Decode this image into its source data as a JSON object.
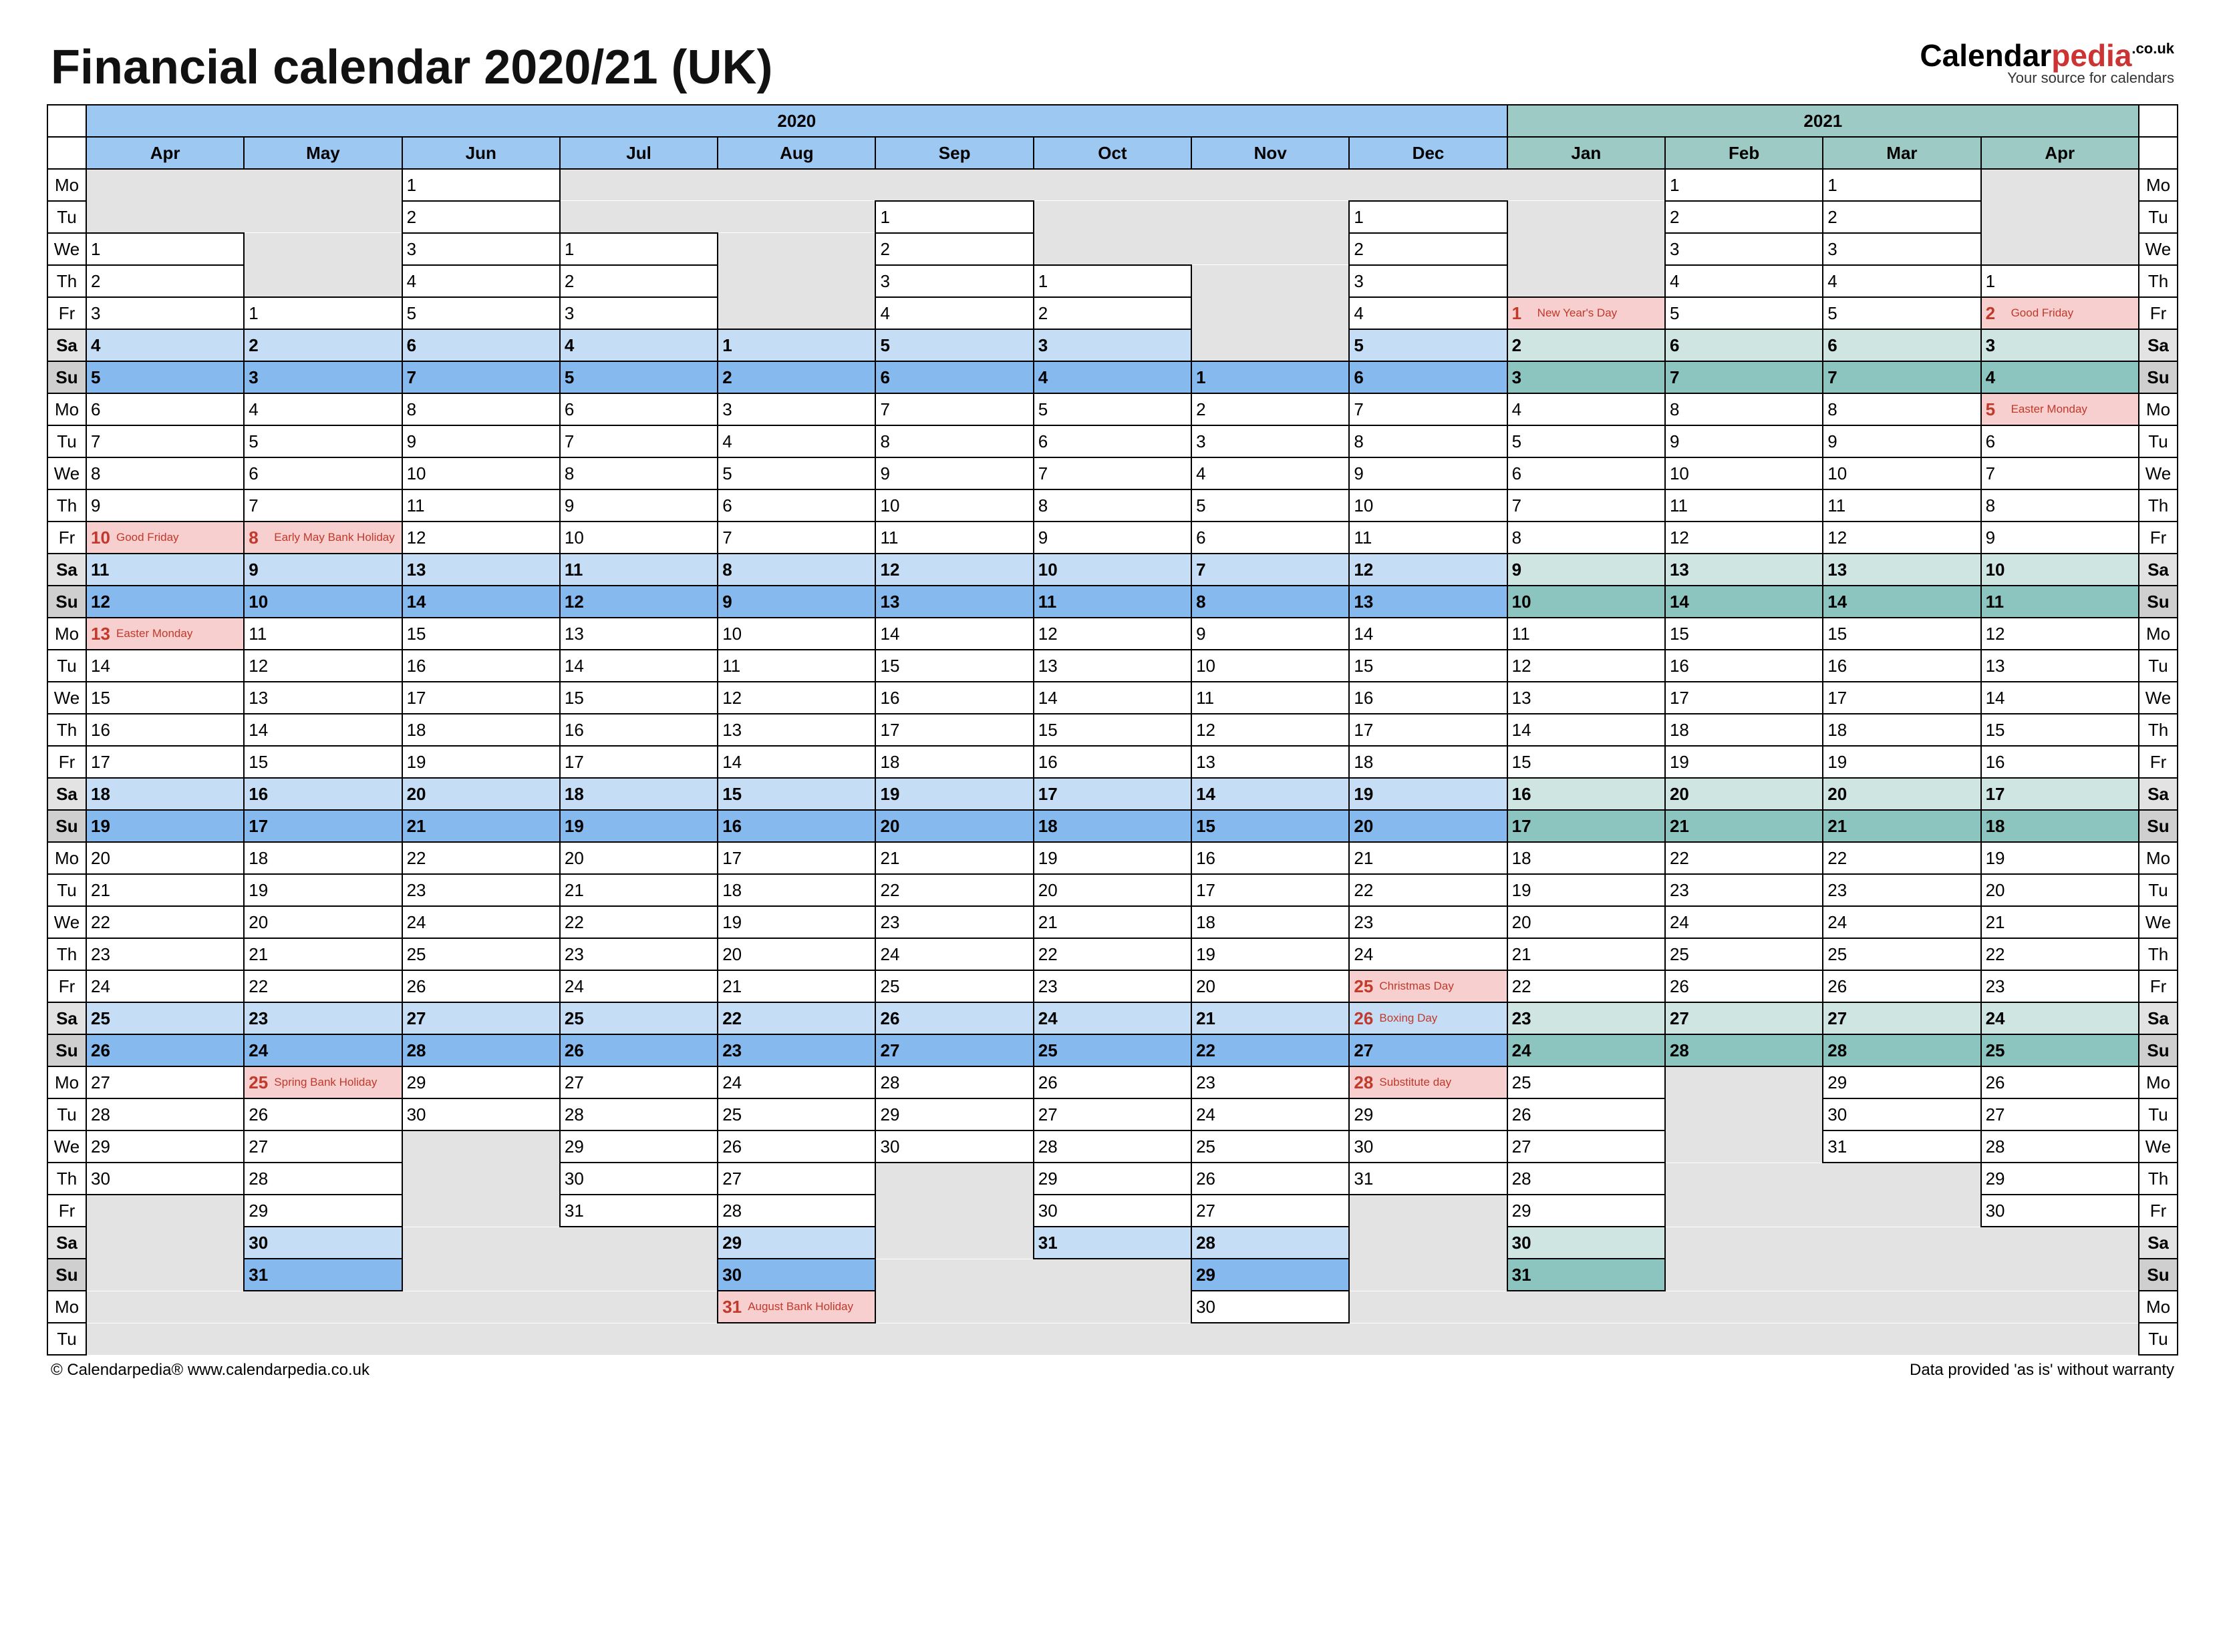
{
  "title": "Financial calendar 2020/21 (UK)",
  "logo": {
    "p1": "Calendar",
    "p2": "pedia",
    "p3": ".co.uk",
    "tag": "Your source for calendars"
  },
  "footer": {
    "left": "© Calendarpedia®   www.calendarpedia.co.uk",
    "right": "Data provided 'as is' without warranty"
  },
  "weekdays": [
    "Mo",
    "Tu",
    "We",
    "Th",
    "Fr",
    "Sa",
    "Su"
  ],
  "years": [
    {
      "label": "2020",
      "span": 9,
      "cls": "y2020"
    },
    {
      "label": "2021",
      "span": 4,
      "cls": "y2021"
    }
  ],
  "months": [
    {
      "label": "Apr",
      "block": 0,
      "start": 2,
      "len": 30,
      "hol": {
        "10": "Good Friday",
        "13": "Easter Monday"
      }
    },
    {
      "label": "May",
      "block": 0,
      "start": 4,
      "len": 31,
      "hol": {
        "8": "Early May Bank Holiday",
        "25": "Spring Bank Holiday"
      }
    },
    {
      "label": "Jun",
      "block": 0,
      "start": 0,
      "len": 30,
      "hol": {}
    },
    {
      "label": "Jul",
      "block": 0,
      "start": 2,
      "len": 31,
      "hol": {}
    },
    {
      "label": "Aug",
      "block": 0,
      "start": 5,
      "len": 31,
      "hol": {
        "31": "August Bank Holiday"
      }
    },
    {
      "label": "Sep",
      "block": 0,
      "start": 1,
      "len": 30,
      "hol": {}
    },
    {
      "label": "Oct",
      "block": 0,
      "start": 3,
      "len": 31,
      "hol": {}
    },
    {
      "label": "Nov",
      "block": 0,
      "start": 6,
      "len": 30,
      "hol": {}
    },
    {
      "label": "Dec",
      "block": 0,
      "start": 1,
      "len": 31,
      "hol": {
        "25": "Christmas Day",
        "26": "Boxing Day",
        "28": "Substitute day"
      }
    },
    {
      "label": "Jan",
      "block": 1,
      "start": 4,
      "len": 31,
      "hol": {
        "1": "New Year's Day"
      }
    },
    {
      "label": "Feb",
      "block": 1,
      "start": 0,
      "len": 28,
      "hol": {}
    },
    {
      "label": "Mar",
      "block": 1,
      "start": 0,
      "len": 31,
      "hol": {}
    },
    {
      "label": "Apr",
      "block": 1,
      "start": 3,
      "len": 30,
      "hol": {
        "2": "Good Friday",
        "5": "Easter Monday"
      }
    }
  ],
  "rows": 37
}
